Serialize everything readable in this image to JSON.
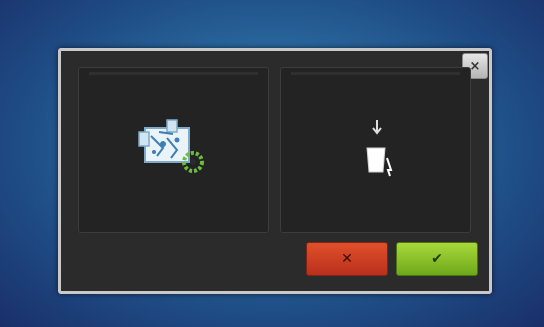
{
  "dialog": {
    "close_label": "×",
    "left_panel": {
      "icon": "embroidery-hoop-icon"
    },
    "right_panel": {
      "icon": "bobbin-thread-icon"
    },
    "cancel_label": "✕",
    "confirm_label": "✔"
  },
  "colors": {
    "background": "#2a6a9e",
    "dialog": "#2b2b2b",
    "cancel": "#d44527",
    "confirm": "#8cc22a"
  }
}
